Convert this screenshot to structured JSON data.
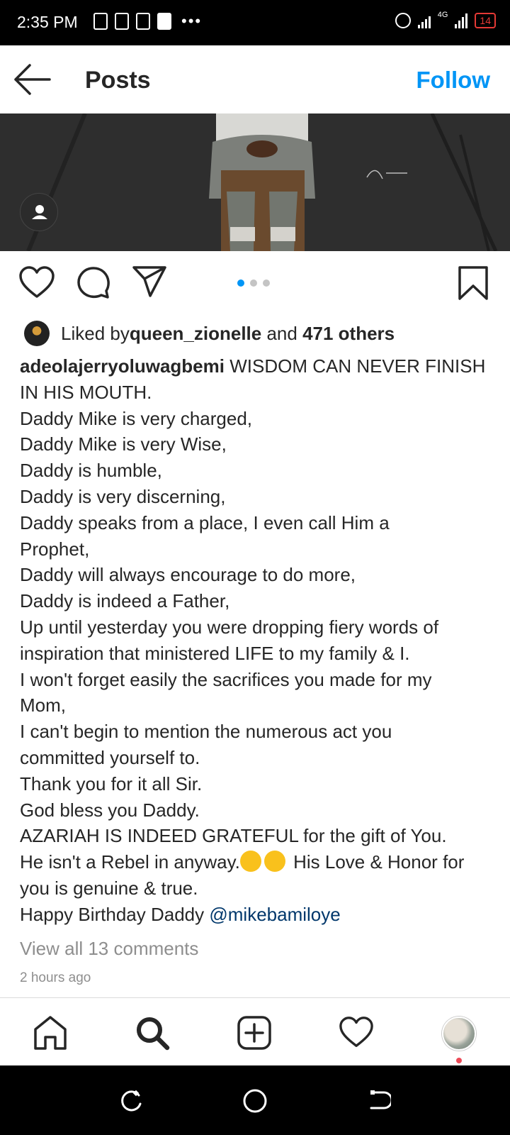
{
  "status_bar": {
    "time": "2:35 PM",
    "network": "4G",
    "battery": "14"
  },
  "header": {
    "title": "Posts",
    "follow_label": "Follow"
  },
  "likes": {
    "prefix": "Liked by ",
    "user": "queen_zionelle",
    "middle": " and ",
    "others": "471 others"
  },
  "caption": {
    "username": "adeolajerryoluwagbemi",
    "lines": [
      " WISDOM CAN NEVER FINISH",
      "IN HIS MOUTH.",
      "Daddy Mike is very charged,",
      "Daddy Mike is very Wise,",
      "Daddy is humble,",
      "Daddy is very discerning,",
      "Daddy speaks from a place, I even call Him a",
      "Prophet,",
      "Daddy will always encourage to do more,",
      "Daddy is indeed a Father,",
      "Up until yesterday you were dropping fiery words of",
      "inspiration that ministered LIFE to my family & I.",
      "I won't forget easily the sacrifices you made for my",
      "Mom,",
      "I can't begin to mention the numerous act you",
      "committed yourself to.",
      "Thank you for it all Sir.",
      "God bless you Daddy.",
      "AZARIAH IS INDEED GRATEFUL for the gift of You.",
      "He isn't a Rebel in anyway.",
      " His Love & Honor for",
      "you is genuine & true.",
      "Happy Birthday Daddy ",
      "@mikebamiloye"
    ]
  },
  "view_comments": "View all 13 comments",
  "timestamp": "2 hours ago",
  "carousel": {
    "count": 3,
    "active": 1
  },
  "colors": {
    "accent": "#0095f6",
    "mention": "#00376b",
    "muted": "#8e8e8e"
  },
  "icons": [
    "back-arrow-icon",
    "user-tag-icon",
    "heart-icon",
    "comment-icon",
    "share-icon",
    "bookmark-icon",
    "home-icon",
    "search-icon",
    "add-post-icon",
    "activity-heart-icon"
  ]
}
